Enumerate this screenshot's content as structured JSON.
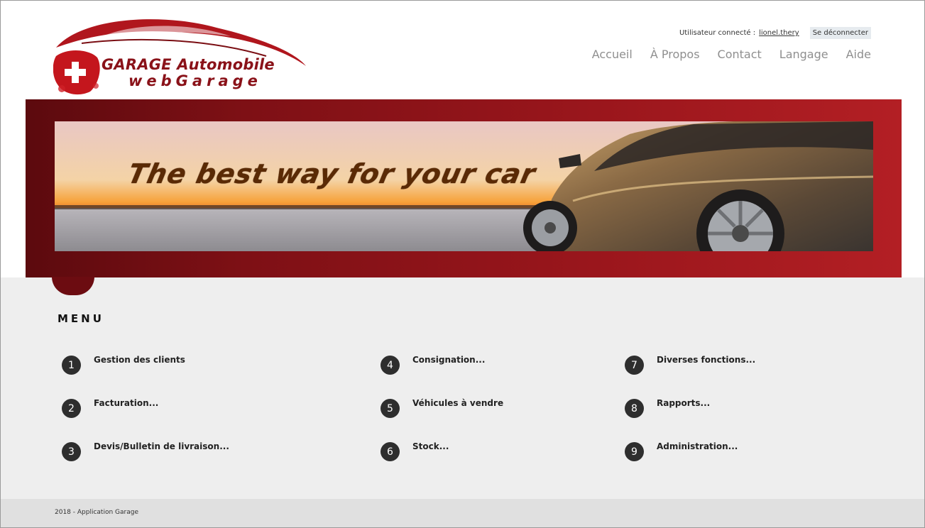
{
  "header": {
    "logo": {
      "line1": "GARAGE Automobile",
      "line2": "webGarage",
      "icon": "swiss-flag-car-logo"
    },
    "user": {
      "label": "Utilisateur connecté :",
      "name": "lionel.thery",
      "logout_label": "Se déconnecter"
    },
    "nav": [
      {
        "label": "Accueil"
      },
      {
        "label": "À Propos"
      },
      {
        "label": "Contact"
      },
      {
        "label": "Langage"
      },
      {
        "label": "Aide"
      }
    ]
  },
  "banner": {
    "tagline": "The best way for your car"
  },
  "menu": {
    "title": "MENU",
    "items": [
      {
        "number": "1",
        "label": "Gestion des clients"
      },
      {
        "number": "2",
        "label": "Facturation..."
      },
      {
        "number": "3",
        "label": "Devis/Bulletin de livraison..."
      },
      {
        "number": "4",
        "label": "Consignation..."
      },
      {
        "number": "5",
        "label": "Véhicules à vendre"
      },
      {
        "number": "6",
        "label": "Stock..."
      },
      {
        "number": "7",
        "label": "Diverses fonctions..."
      },
      {
        "number": "8",
        "label": "Rapports..."
      },
      {
        "number": "9",
        "label": "Administration..."
      }
    ]
  },
  "footer": {
    "text": "2018 - Application Garage"
  },
  "colors": {
    "brand_red": "#9a161c",
    "brand_dark_red": "#5c0a0e",
    "nav_gray": "#8f8f8f",
    "menu_bg": "#eeeeee",
    "number_badge": "#2e2e2e"
  }
}
